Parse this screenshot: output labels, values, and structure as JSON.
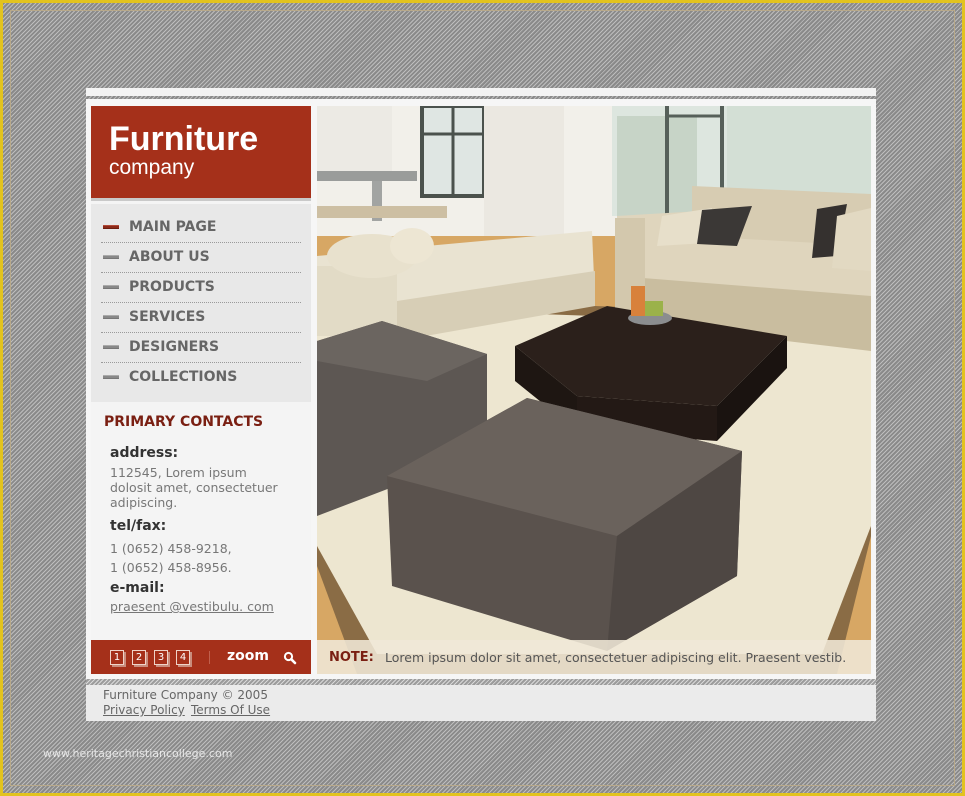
{
  "brand": {
    "title": "Furniture",
    "subtitle": "company",
    "accent_color": "#a5301a",
    "background_color": "#9a9a9a",
    "frame_color": "#e2c31f"
  },
  "nav": {
    "items": [
      {
        "label": "MAIN PAGE",
        "active": true
      },
      {
        "label": "ABOUT US",
        "active": false
      },
      {
        "label": "PRODUCTS",
        "active": false
      },
      {
        "label": "SERVICES",
        "active": false
      },
      {
        "label": "DESIGNERS",
        "active": false
      },
      {
        "label": "COLLECTIONS",
        "active": false
      }
    ]
  },
  "contacts": {
    "title": "PRIMARY CONTACTS",
    "address_label": "address:",
    "address_lines": [
      "112545,  Lorem ipsum",
      "dolosit amet, consectetuer",
      "adipiscing."
    ],
    "tel_label": "tel/fax:",
    "tel_lines": [
      "1 (0652) 458-9218,",
      "1 (0652) 458-8956."
    ],
    "email_label": "e-mail:",
    "email": "praesent @vestibulu. com"
  },
  "gallery": {
    "pages": [
      "1",
      "2",
      "3",
      "4"
    ],
    "zoom_label": "zoom",
    "zoom_icon": "magnifier-icon",
    "image_alt": "Living room with beige sofas, dark ottomans and coffee table"
  },
  "note": {
    "label": "NOTE:",
    "text": "Lorem ipsum dolor sit amet, consectetuer adipiscing elit. Praesent vestib."
  },
  "footer": {
    "copyright": "Furniture Company  © 2005",
    "links": [
      "Privacy Policy",
      "Terms Of Use"
    ]
  },
  "watermark": "www.heritagechristiancollege.com"
}
